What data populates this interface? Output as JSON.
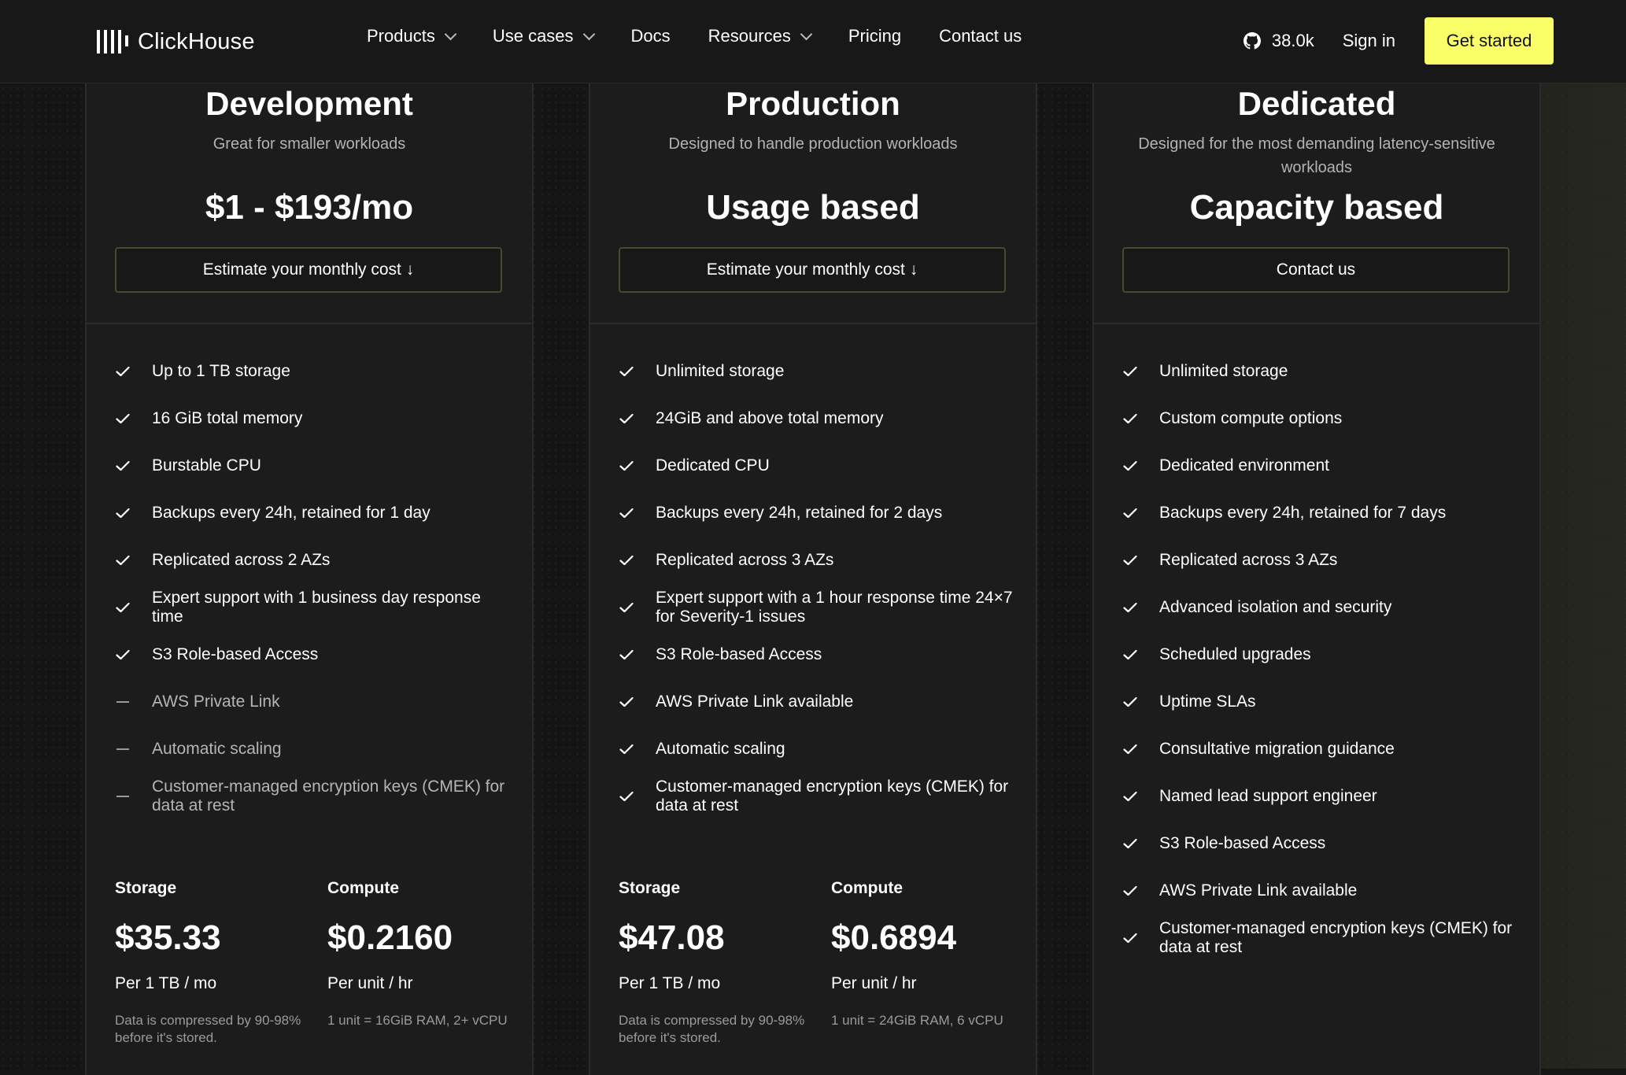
{
  "nav": {
    "logo_text": "ClickHouse",
    "links": [
      {
        "label": "Products",
        "dropdown": true
      },
      {
        "label": "Use cases",
        "dropdown": true
      },
      {
        "label": "Docs",
        "dropdown": false
      },
      {
        "label": "Resources",
        "dropdown": true
      },
      {
        "label": "Pricing",
        "dropdown": false
      },
      {
        "label": "Contact us",
        "dropdown": false
      }
    ],
    "github_stars": "38.0k",
    "sign_in": "Sign in",
    "get_started": "Get started"
  },
  "colors": {
    "accent": "#faff69",
    "background": "#151515",
    "card": "#1c1c1c"
  },
  "plans": [
    {
      "title": "Development",
      "subtitle": "Great for smaller workloads",
      "price": "$1 - $193/mo",
      "cta": "Estimate your monthly cost ↓",
      "features": [
        {
          "text": "Up to 1 TB storage",
          "included": true
        },
        {
          "text": "16 GiB total memory",
          "included": true
        },
        {
          "text": "Burstable CPU",
          "included": true
        },
        {
          "text": "Backups every 24h, retained for 1 day",
          "included": true
        },
        {
          "text": "Replicated across 2 AZs",
          "included": true
        },
        {
          "text": "Expert support with 1 business day response time",
          "included": true
        },
        {
          "text": "S3 Role-based Access",
          "included": true
        },
        {
          "text": "AWS Private Link",
          "included": false
        },
        {
          "text": "Automatic scaling",
          "included": false
        },
        {
          "text": "Customer-managed encryption keys (CMEK) for data at rest",
          "included": false
        }
      ],
      "storage": {
        "label": "Storage",
        "value": "$35.33",
        "unit": "Per 1 TB / mo",
        "note": "Data is compressed by 90-98% before it's stored."
      },
      "compute": {
        "label": "Compute",
        "value": "$0.2160",
        "unit": "Per unit / hr",
        "note": "1 unit = 16GiB RAM, 2+ vCPU"
      }
    },
    {
      "title": "Production",
      "subtitle": "Designed to handle production workloads",
      "price": "Usage based",
      "cta": "Estimate your monthly cost ↓",
      "features": [
        {
          "text": "Unlimited storage",
          "included": true
        },
        {
          "text": "24GiB and above total memory",
          "included": true
        },
        {
          "text": "Dedicated CPU",
          "included": true
        },
        {
          "text": "Backups every 24h, retained for 2 days",
          "included": true
        },
        {
          "text": "Replicated across 3 AZs",
          "included": true
        },
        {
          "text": "Expert support with a 1 hour response time 24×7 for Severity-1 issues",
          "included": true
        },
        {
          "text": "S3 Role-based Access",
          "included": true
        },
        {
          "text": "AWS Private Link available",
          "included": true
        },
        {
          "text": "Automatic scaling",
          "included": true
        },
        {
          "text": "Customer-managed encryption keys (CMEK) for data at rest",
          "included": true
        }
      ],
      "storage": {
        "label": "Storage",
        "value": "$47.08",
        "unit": "Per 1 TB / mo",
        "note": "Data is compressed by 90-98% before it's stored."
      },
      "compute": {
        "label": "Compute",
        "value": "$0.6894",
        "unit": "Per unit / hr",
        "note": "1 unit = 24GiB RAM, 6 vCPU"
      }
    },
    {
      "title": "Dedicated",
      "subtitle": "Designed for the most demanding latency-sensitive workloads",
      "price": "Capacity based",
      "cta": "Contact us",
      "features": [
        {
          "text": "Unlimited storage",
          "included": true
        },
        {
          "text": "Custom compute options",
          "included": true
        },
        {
          "text": "Dedicated environment",
          "included": true
        },
        {
          "text": "Backups every 24h, retained for 7 days",
          "included": true
        },
        {
          "text": "Replicated across 3 AZs",
          "included": true
        },
        {
          "text": "Advanced isolation and security",
          "included": true
        },
        {
          "text": "Scheduled upgrades",
          "included": true
        },
        {
          "text": "Uptime SLAs",
          "included": true
        },
        {
          "text": "Consultative migration guidance",
          "included": true
        },
        {
          "text": "Named lead support engineer",
          "included": true
        },
        {
          "text": "S3 Role-based Access",
          "included": true
        },
        {
          "text": "AWS Private Link available",
          "included": true
        },
        {
          "text": "Customer-managed encryption keys (CMEK) for data at rest",
          "included": true
        }
      ]
    }
  ]
}
